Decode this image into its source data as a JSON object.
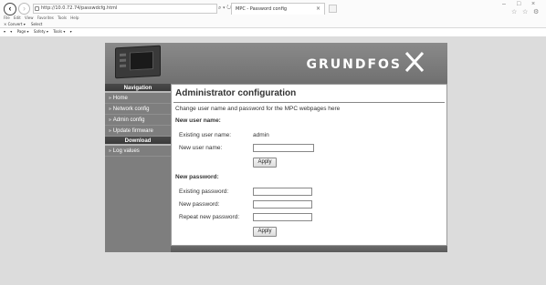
{
  "browser": {
    "url": "http://10.0.72.74/passwdcfg.html",
    "tab_title": "MPC - Password config",
    "tab_close": "×",
    "addr_actions": "⌕ ▾ ↻",
    "window_controls": [
      "–",
      "□",
      "×"
    ],
    "toolbar_icons": [
      "☆",
      "☆",
      "⚙"
    ],
    "menu": [
      "File",
      "Edit",
      "View",
      "Favorites",
      "Tools",
      "Help"
    ],
    "favorites": [
      "× Convert ▾",
      "Select"
    ],
    "commands": [
      "▾",
      "▾",
      "Page ▾",
      "Safety ▾",
      "Tools ▾",
      "▾"
    ]
  },
  "header": {
    "logo_text": "GRUNDFOS",
    "logo_mark": "X",
    "brand_color": "#ffffff"
  },
  "sidebar": {
    "navigation_heading": "Navigation",
    "nav_items": [
      {
        "label": "Home"
      },
      {
        "label": "Network config"
      },
      {
        "label": "Admin config"
      },
      {
        "label": "Update firmware"
      }
    ],
    "download_heading": "Download",
    "download_items": [
      {
        "label": "Log values"
      }
    ]
  },
  "main": {
    "title": "Administrator configuration",
    "description": "Change user name and password for the MPC webpages here",
    "user_section": {
      "heading": "New user name:",
      "existing_label": "Existing user name:",
      "existing_value": "admin",
      "new_label": "New user name:",
      "new_value": "",
      "apply_label": "Apply"
    },
    "password_section": {
      "heading": "New password:",
      "existing_label": "Existing password:",
      "new_label": "New password:",
      "repeat_label": "Repeat new password:",
      "apply_label": "Apply"
    }
  }
}
